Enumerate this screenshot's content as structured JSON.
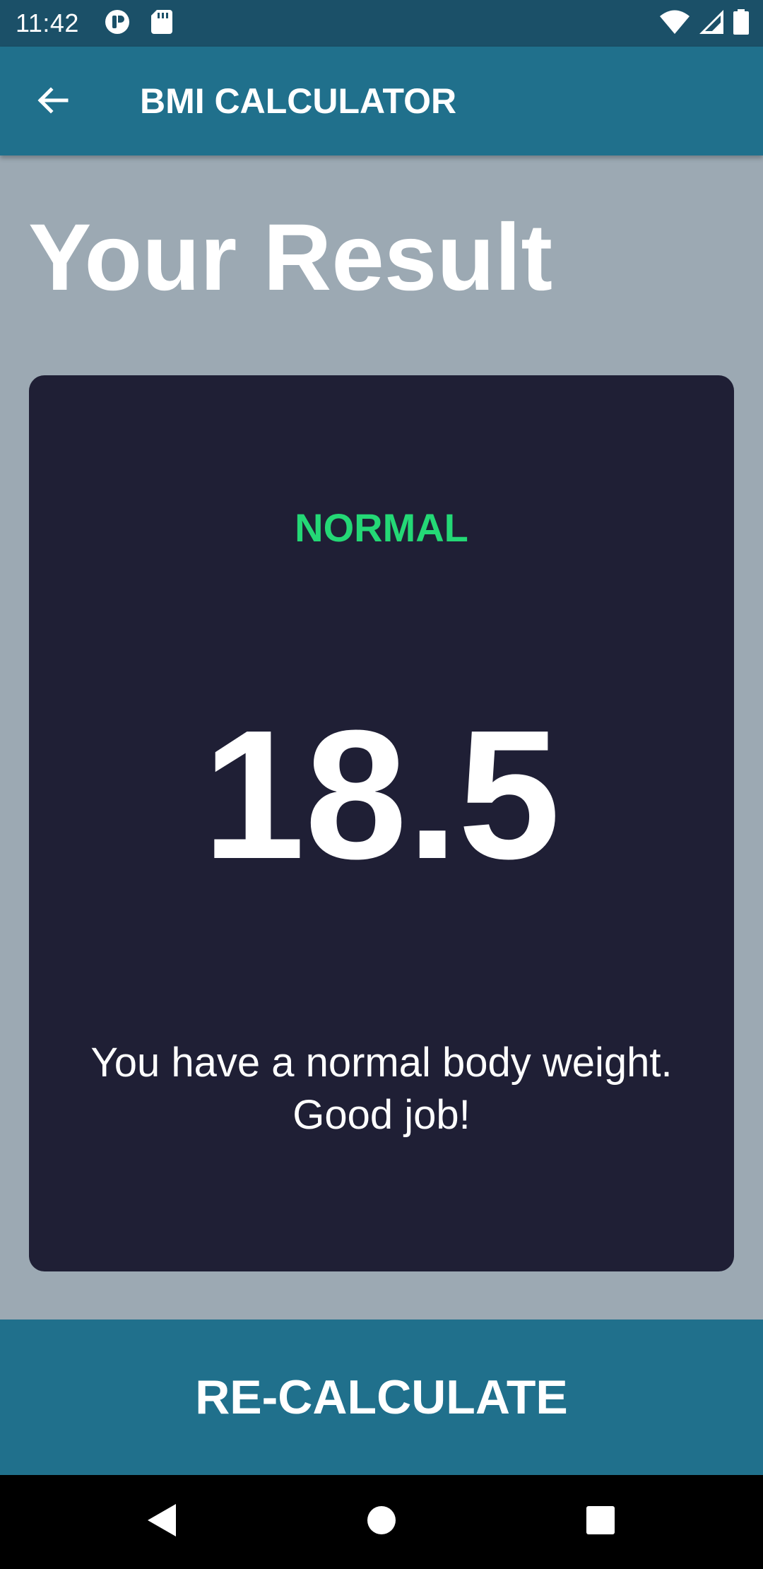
{
  "status_bar": {
    "time": "11:42",
    "icons": [
      "app-notification-icon",
      "sd-card-icon",
      "wifi-icon",
      "cellular-signal-icon",
      "battery-icon"
    ]
  },
  "app_bar": {
    "title": "BMI CALCULATOR",
    "back_icon": "arrow-back-icon"
  },
  "main": {
    "heading": "Your Result",
    "result": {
      "status": "NORMAL",
      "value": "18.5",
      "message": "You have a normal body weight. Good job!"
    },
    "recalculate_label": "RE-CALCULATE"
  },
  "nav_bar": {
    "icons": [
      "back-triangle-icon",
      "home-circle-icon",
      "recents-square-icon"
    ]
  },
  "colors": {
    "background": "#9ca9b3",
    "status_bar": "#1b5068",
    "app_bar": "#20708c",
    "card": "#1f1f35",
    "status_green": "#24d876",
    "text": "#ffffff"
  }
}
